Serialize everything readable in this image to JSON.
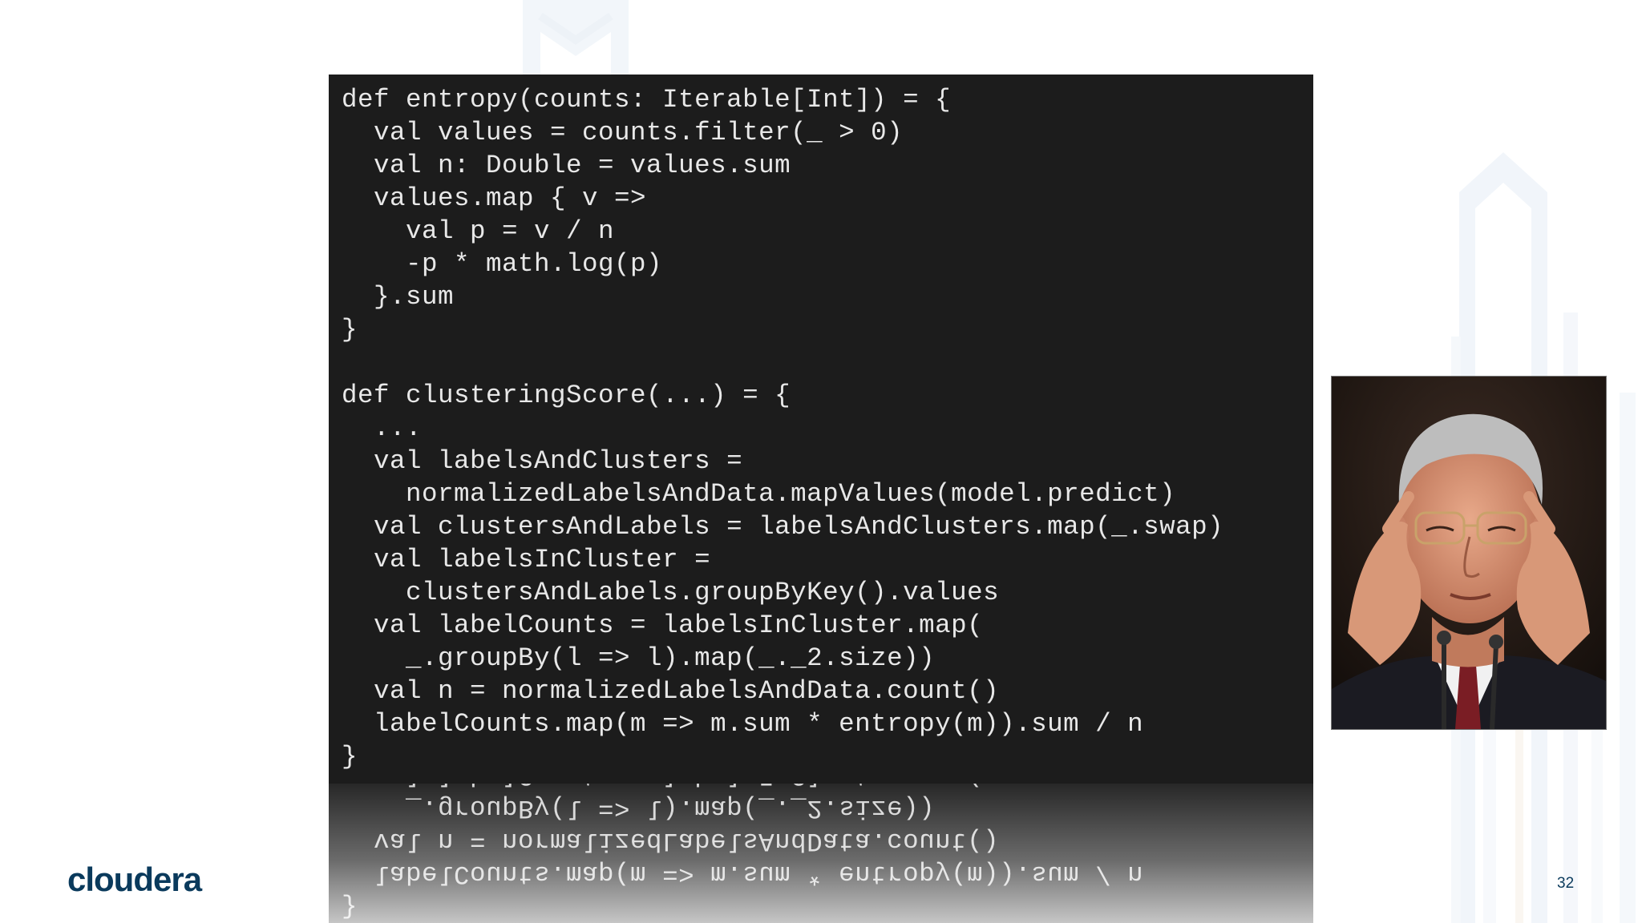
{
  "slide": {
    "logo_text": "cloudera",
    "page_number": "32",
    "photo_subject": "person-thinking-photo"
  },
  "code": {
    "lines": [
      "def entropy(counts: Iterable[Int]) = {",
      "  val values = counts.filter(_ > 0)",
      "  val n: Double = values.sum",
      "  values.map { v =>",
      "    val p = v / n",
      "    -p * math.log(p)",
      "  }.sum",
      "}",
      "",
      "def clusteringScore(...) = {",
      "  ...",
      "  val labelsAndClusters =",
      "    normalizedLabelsAndData.mapValues(model.predict)",
      "  val clustersAndLabels = labelsAndClusters.map(_.swap)",
      "  val labelsInCluster =",
      "    clustersAndLabels.groupByKey().values",
      "  val labelCounts = labelsInCluster.map(",
      "    _.groupBy(l => l).map(_._2.size))",
      "  val n = normalizedLabelsAndData.count()",
      "  labelCounts.map(m => m.sum * entropy(m)).sum / n",
      "}"
    ]
  },
  "colors": {
    "code_background": "#1c1c1c",
    "code_text": "#e8e8e8",
    "brand": "#0a3a5c"
  }
}
